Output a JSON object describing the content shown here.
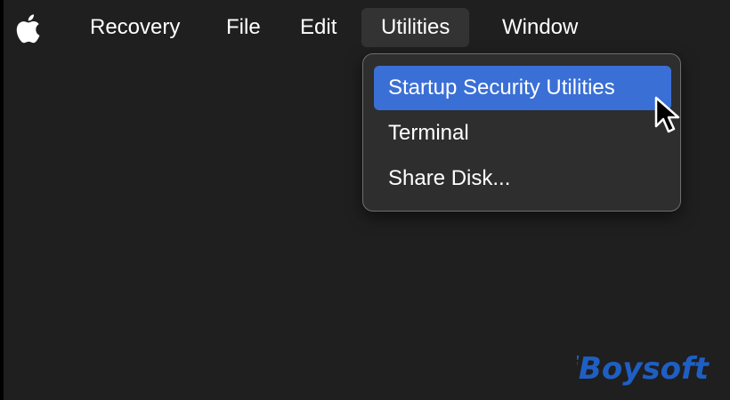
{
  "menubar": {
    "apple_icon": "apple-logo-icon",
    "items": [
      {
        "label": "Recovery"
      },
      {
        "label": "File"
      },
      {
        "label": "Edit"
      },
      {
        "label": "Utilities"
      },
      {
        "label": "Window"
      }
    ]
  },
  "utilities_menu": {
    "items": [
      {
        "label": "Startup Security Utilities"
      },
      {
        "label": "Terminal"
      },
      {
        "label": "Share Disk..."
      }
    ]
  },
  "cursor_icon": "arrow-pointer-icon",
  "watermark": {
    "text": "iBoysoft"
  },
  "colors": {
    "background": "#1f1f1f",
    "menu_active": "#333333",
    "dropdown_bg": "#2e2e2e",
    "highlight": "#3a6fd6",
    "watermark": "#1f5fc4"
  }
}
